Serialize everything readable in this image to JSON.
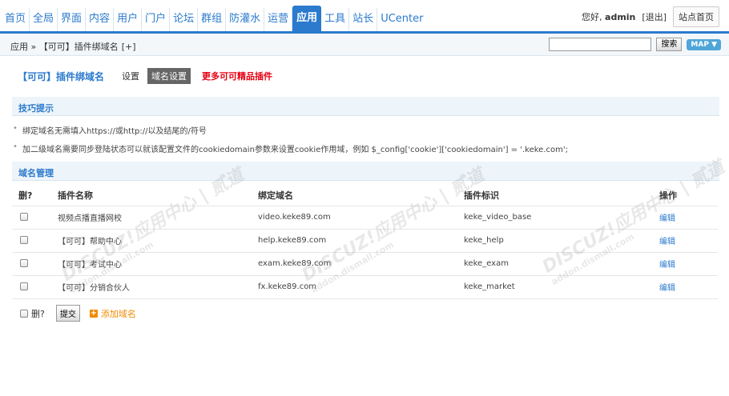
{
  "nav": {
    "items": [
      "首页",
      "全局",
      "界面",
      "内容",
      "用户",
      "门户",
      "论坛",
      "群组",
      "防灌水",
      "运营",
      "应用",
      "工具",
      "站长",
      "UCenter"
    ],
    "active_index": 10
  },
  "user": {
    "greeting": "您好,",
    "name": "admin",
    "logout": "[退出]",
    "home_button": "站点首页"
  },
  "breadcrumb": {
    "text": "应用 » 【可可】插件绑域名",
    "plus": "[+]"
  },
  "search": {
    "button": "搜索",
    "map": "MAP ▼"
  },
  "plugin": {
    "title": "【可可】插件绑域名",
    "tab_settings": "设置",
    "tab_domain": "域名设置",
    "more": "更多可可精品插件"
  },
  "tips": {
    "header": "技巧提示",
    "items": [
      "绑定域名无需填入https://或http://以及结尾的/符号",
      "加二级域名需要同步登陆状态可以就该配置文件的cookiedomain参数来设置cookie作用域，例如 $_config['cookie']['cookiedomain'] = '.keke.com';"
    ]
  },
  "domains": {
    "header": "域名管理",
    "columns": [
      "删?",
      "插件名称",
      "绑定域名",
      "插件标识",
      "操作"
    ],
    "rows": [
      {
        "name": "视频点播直播网校",
        "domain": "video.keke89.com",
        "id": "keke_video_base",
        "action": "编辑"
      },
      {
        "name": "【可可】帮助中心",
        "domain": "help.keke89.com",
        "id": "keke_help",
        "action": "编辑"
      },
      {
        "name": "【可可】考试中心",
        "domain": "exam.keke89.com",
        "id": "keke_exam",
        "action": "编辑"
      },
      {
        "name": "【可可】分销合伙人",
        "domain": "fx.keke89.com",
        "id": "keke_market",
        "action": "编辑"
      }
    ],
    "footer_delete": "删?",
    "submit": "提交",
    "add": "添加域名",
    "add_icon": "+"
  },
  "watermark": {
    "brand": "DISCUZ!应用中心 | 贰道",
    "url": "addon.dismall.com"
  }
}
